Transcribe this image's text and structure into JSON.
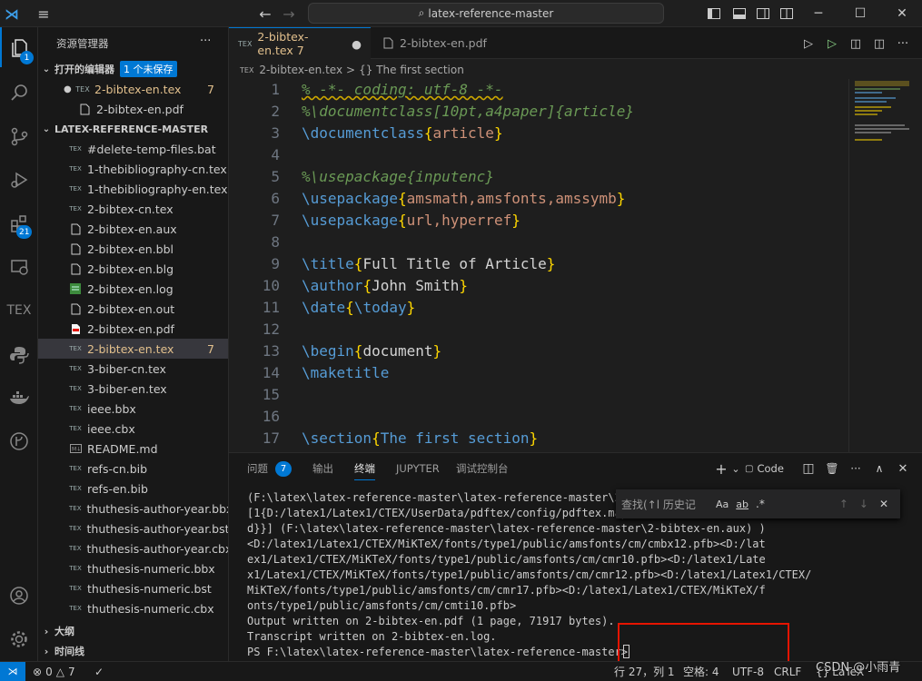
{
  "titlebar": {
    "search": "latex-reference-master",
    "minimize": "─",
    "maximize": "☐",
    "close": "✕"
  },
  "activity": {
    "explorer_badge": "1",
    "extensions_badge": "21",
    "tex_label": "TEX"
  },
  "sidebar": {
    "title": "资源管理器",
    "more": "···",
    "open_editors": {
      "label": "打开的编辑器",
      "unsaved": "1 个未保存",
      "items": [
        {
          "name": "2-bibtex-en.tex",
          "count": "7",
          "modified": "●",
          "icon": "TEX"
        },
        {
          "name": "2-bibtex-en.pdf",
          "icon": "PDF"
        }
      ]
    },
    "project": {
      "label": "LATEX-REFERENCE-MASTER",
      "files": [
        {
          "name": "#delete-temp-files.bat",
          "icon": "TEX"
        },
        {
          "name": "1-thebibliography-cn.tex",
          "icon": "TEX"
        },
        {
          "name": "1-thebibliography-en.tex",
          "icon": "TEX"
        },
        {
          "name": "2-bibtex-cn.tex",
          "icon": "TEX"
        },
        {
          "name": "2-bibtex-en.aux",
          "icon": "FILE"
        },
        {
          "name": "2-bibtex-en.bbl",
          "icon": "FILE"
        },
        {
          "name": "2-bibtex-en.blg",
          "icon": "FILE"
        },
        {
          "name": "2-bibtex-en.log",
          "icon": "LOG"
        },
        {
          "name": "2-bibtex-en.out",
          "icon": "FILE"
        },
        {
          "name": "2-bibtex-en.pdf",
          "icon": "PDF"
        },
        {
          "name": "2-bibtex-en.tex",
          "icon": "TEX",
          "count": "7",
          "selected": true
        },
        {
          "name": "3-biber-cn.tex",
          "icon": "TEX"
        },
        {
          "name": "3-biber-en.tex",
          "icon": "TEX"
        },
        {
          "name": "ieee.bbx",
          "icon": "TEX"
        },
        {
          "name": "ieee.cbx",
          "icon": "TEX"
        },
        {
          "name": "README.md",
          "icon": "MD"
        },
        {
          "name": "refs-cn.bib",
          "icon": "TEX"
        },
        {
          "name": "refs-en.bib",
          "icon": "TEX"
        },
        {
          "name": "thuthesis-author-year.bbx",
          "icon": "TEX"
        },
        {
          "name": "thuthesis-author-year.bst",
          "icon": "TEX"
        },
        {
          "name": "thuthesis-author-year.cbx",
          "icon": "TEX"
        },
        {
          "name": "thuthesis-numeric.bbx",
          "icon": "TEX"
        },
        {
          "name": "thuthesis-numeric.bst",
          "icon": "TEX"
        },
        {
          "name": "thuthesis-numeric.cbx",
          "icon": "TEX"
        }
      ]
    },
    "outline": "大纲",
    "timeline": "时间线"
  },
  "tabs": [
    {
      "label": "2-bibtex-en.tex 7",
      "modified": "●",
      "icon": "TEX",
      "active": true
    },
    {
      "label": "2-bibtex-en.pdf",
      "icon": "PDF",
      "active": false
    }
  ],
  "breadcrumb": {
    "file": "2-bibtex-en.tex",
    "sep": ">",
    "symbol": "{} The first section"
  },
  "code_lines": [
    {
      "n": "1",
      "parts": [
        [
          "c",
          "% -*- coding: utf-8 -*-"
        ]
      ]
    },
    {
      "n": "2",
      "parts": [
        [
          "c",
          "%\\documentclass[10pt,a4paper]{article}"
        ]
      ]
    },
    {
      "n": "3",
      "parts": [
        [
          "k",
          "\\documentclass"
        ],
        [
          "b",
          "{"
        ],
        [
          "a",
          "article"
        ],
        [
          "b",
          "}"
        ]
      ]
    },
    {
      "n": "4",
      "parts": []
    },
    {
      "n": "5",
      "parts": [
        [
          "c",
          "%\\usepackage{inputenc}"
        ]
      ]
    },
    {
      "n": "6",
      "parts": [
        [
          "k",
          "\\usepackage"
        ],
        [
          "b",
          "{"
        ],
        [
          "a",
          "amsmath,amsfonts,amssymb"
        ],
        [
          "b",
          "}"
        ]
      ]
    },
    {
      "n": "7",
      "parts": [
        [
          "k",
          "\\usepackage"
        ],
        [
          "b",
          "{"
        ],
        [
          "a",
          "url,hyperref"
        ],
        [
          "b",
          "}"
        ]
      ]
    },
    {
      "n": "8",
      "parts": []
    },
    {
      "n": "9",
      "parts": [
        [
          "k",
          "\\title"
        ],
        [
          "b",
          "{"
        ],
        [
          "t",
          "Full Title of Article"
        ],
        [
          "b",
          "}"
        ]
      ]
    },
    {
      "n": "10",
      "parts": [
        [
          "k",
          "\\author"
        ],
        [
          "b",
          "{"
        ],
        [
          "t",
          "John Smith"
        ],
        [
          "b",
          "}"
        ]
      ]
    },
    {
      "n": "11",
      "parts": [
        [
          "k",
          "\\date"
        ],
        [
          "b",
          "{"
        ],
        [
          "k",
          "\\today"
        ],
        [
          "b",
          "}"
        ]
      ]
    },
    {
      "n": "12",
      "parts": []
    },
    {
      "n": "13",
      "parts": [
        [
          "k",
          "\\begin"
        ],
        [
          "b",
          "{"
        ],
        [
          "t",
          "document"
        ],
        [
          "b",
          "}"
        ]
      ]
    },
    {
      "n": "14",
      "parts": [
        [
          "k",
          "\\maketitle"
        ]
      ]
    },
    {
      "n": "15",
      "parts": []
    },
    {
      "n": "16",
      "parts": []
    },
    {
      "n": "17",
      "parts": [
        [
          "k",
          "\\section"
        ],
        [
          "b",
          "{"
        ],
        [
          "k",
          "The first section"
        ],
        [
          "b",
          "}"
        ]
      ]
    }
  ],
  "panel": {
    "tabs": [
      {
        "label": "问题",
        "badge": "7"
      },
      {
        "label": "输出"
      },
      {
        "label": "终端",
        "active": true
      },
      {
        "label": "JUPYTER"
      },
      {
        "label": "调试控制台"
      }
    ],
    "actions": {
      "add": "+",
      "dropdown": "⌄",
      "code": "Code",
      "split": "◫",
      "trash": "🗑",
      "more": "···",
      "up": "∧",
      "close": "✕"
    },
    "find": {
      "placeholder": "查找(↑l 历史记",
      "case": "Aa",
      "word": "ab",
      "regex": ".*",
      "up": "↑",
      "down": "↓",
      "close": "✕"
    },
    "terminal": [
      "(F:\\latex\\latex-reference-master\\latex-reference-master\\2-",
      "[1{D:/latex1/Latex1/CTEX/UserData/pdftex/config/pdftex.map",
      "d}}] (F:\\latex\\latex-reference-master\\latex-reference-master\\2-bibtex-en.aux) )",
      "<D:/latex1/Latex1/CTEX/MiKTeX/fonts/type1/public/amsfonts/cm/cmbx12.pfb><D:/lat",
      "ex1/Latex1/CTEX/MiKTeX/fonts/type1/public/amsfonts/cm/cmr10.pfb><D:/latex1/Late",
      "x1/Latex1/CTEX/MiKTeX/fonts/type1/public/amsfonts/cm/cmr12.pfb><D:/latex1/Latex1/CTEX/",
      "MiKTeX/fonts/type1/public/amsfonts/cm/cmr17.pfb><D:/latex1/Latex1/CTEX/MiKTeX/f",
      "onts/type1/public/amsfonts/cm/cmti10.pfb>",
      "Output written on 2-bibtex-en.pdf (1 page, 71917 bytes).",
      "Transcript written on 2-bibtex-en.log.",
      "PS F:\\latex\\latex-reference-master\\latex-reference-master>"
    ]
  },
  "status": {
    "errors": "0",
    "warnings": "7",
    "position": "行 27，列 1",
    "spaces": "空格: 4",
    "encoding": "UTF-8",
    "eol": "CRLF",
    "language": "LaTeX",
    "watermark": "CSDN @小雨青"
  },
  "colors": {
    "accent": "#0078d4",
    "modified": "#e2c08d",
    "highlight_box": "#e51400"
  }
}
